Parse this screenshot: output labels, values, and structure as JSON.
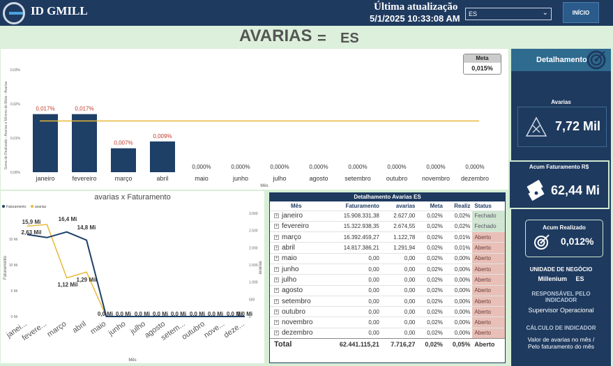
{
  "header": {
    "brand": "ID GMILL",
    "update_label": "Última atualização",
    "update_value": "5/1/2025 10:33:08 AM",
    "filter_value": "ES",
    "home_button": "INÍCIO"
  },
  "title": {
    "main": "AVARIAS",
    "dash": "=",
    "uf": "ES"
  },
  "chart_data": [
    {
      "type": "bar",
      "title": "",
      "ylabel": "Soma de Realizado - Avarias e Mínimo de Meta - Avarias",
      "xlabel": "Mês",
      "categories": [
        "janeiro",
        "fevereiro",
        "março",
        "abril",
        "maio",
        "junho",
        "julho",
        "agosto",
        "setembro",
        "outubro",
        "novembro",
        "dezembro"
      ],
      "values": [
        0.017,
        0.017,
        0.007,
        0.009,
        0,
        0,
        0,
        0,
        0,
        0,
        0,
        0
      ],
      "data_labels": [
        "0,017%",
        "0,017%",
        "0,007%",
        "0,009%",
        "0,000%",
        "0,000%",
        "0,000%",
        "0,000%",
        "0,000%",
        "0,000%",
        "0,000%",
        "0,000%"
      ],
      "meta_line": 0.015,
      "ylim": [
        0,
        0.03
      ],
      "yticks": [
        "0,00%",
        "0,01%",
        "0,02%",
        "0,03%"
      ],
      "colors": {
        "bar": "#1e3f66",
        "meta": "#e8b838",
        "label_pos": "#c0392b",
        "label_zero": "#333333"
      },
      "meta_card": {
        "label": "Meta",
        "value": "0,015%"
      }
    },
    {
      "type": "line",
      "title": "avarias x Faturamento",
      "xlabel": "Mês",
      "ylabel_left": "Faturamento",
      "ylabel_right": "avarias",
      "categories": [
        "janei...",
        "fevere...",
        "março",
        "abril",
        "maio",
        "junho",
        "julho",
        "agosto",
        "setem...",
        "outubro",
        "nove...",
        "deze..."
      ],
      "series": [
        {
          "name": "Faturamento",
          "color": "#1e3f66",
          "values": [
            15.9,
            15.3,
            16.4,
            14.8,
            0,
            0,
            0,
            0,
            0,
            0,
            0,
            0
          ]
        },
        {
          "name": "avarias",
          "color": "#e8b838",
          "values": [
            2627,
            2674.55,
            1122.78,
            1291.94,
            0,
            0,
            0,
            0,
            0,
            0,
            0,
            0
          ]
        }
      ],
      "data_labels": [
        "15,9 Mi",
        "2,63 Mil",
        "16,4 Mi",
        "14,8 Mi",
        "1,12 Mil",
        "1,29 Mil",
        "0,0 Mi",
        "0,0 Mi",
        "0,0 Mi",
        "0,0 Mi",
        "0,0 Mi",
        "0,0 Mi",
        "0,0 Mi",
        "0,0 Mi",
        "0,0 Mi"
      ],
      "ylim_left": [
        0,
        20
      ],
      "ylim_right": [
        0,
        3000
      ],
      "yticks_left": [
        "0 Mi",
        "5 Mi",
        "10 Mi",
        "15 Mi"
      ],
      "yticks_right": [
        "0",
        "500",
        "1.000",
        "1.500",
        "2.000",
        "2.500",
        "3.000"
      ]
    }
  ],
  "table": {
    "title": "Detalhamento Avarias ES",
    "columns": [
      "Mês",
      "Faturamento",
      "avarias",
      "Meta",
      "Realiz",
      "Status"
    ],
    "rows": [
      [
        "janeiro",
        "15.908.331,38",
        "2.627,00",
        "0,02%",
        "0,02%",
        "Fechado"
      ],
      [
        "fevereiro",
        "15.322.938,35",
        "2.674,55",
        "0,02%",
        "0,02%",
        "Fechado"
      ],
      [
        "março",
        "16.392.459,27",
        "1.122,78",
        "0,02%",
        "0,01%",
        "Aberto"
      ],
      [
        "abril",
        "14.817.386,21",
        "1.291,94",
        "0,02%",
        "0,01%",
        "Aberto"
      ],
      [
        "maio",
        "0,00",
        "0,00",
        "0,02%",
        "0,00%",
        "Aberto"
      ],
      [
        "junho",
        "0,00",
        "0,00",
        "0,02%",
        "0,00%",
        "Aberto"
      ],
      [
        "julho",
        "0,00",
        "0,00",
        "0,02%",
        "0,00%",
        "Aberto"
      ],
      [
        "agosto",
        "0,00",
        "0,00",
        "0,02%",
        "0,00%",
        "Aberto"
      ],
      [
        "setembro",
        "0,00",
        "0,00",
        "0,02%",
        "0,00%",
        "Aberto"
      ],
      [
        "outubro",
        "0,00",
        "0,00",
        "0,02%",
        "0,00%",
        "Aberto"
      ],
      [
        "novembro",
        "0,00",
        "0,00",
        "0,02%",
        "0,00%",
        "Aberto"
      ],
      [
        "dezembro",
        "0,00",
        "0,00",
        "0,02%",
        "0,00%",
        "Aberto"
      ]
    ],
    "total": [
      "Total",
      "62.441.115,21",
      "7.716,27",
      "0,02%",
      "0,05%",
      "Aberto"
    ]
  },
  "side": {
    "header": "Detalhamento",
    "avarias_label": "Avarias",
    "avarias_value": "7,72 Mil",
    "fat_label": "Acum Faturamento R$",
    "fat_value": "62,44 Mi",
    "real_label": "Acum Realizado",
    "real_value": "0,012%",
    "un_label": "UNIDADE DE NEGÓCIO",
    "un_value_name": "Millenium",
    "un_value_uf": "ES",
    "resp_label": "RESPONSÁVEL PELO INDICADOR",
    "resp_value": "Supervisor Operacional",
    "calc_label": "CÁLCULO DE INDICADOR",
    "calc_value": "Valor de avarias no mês / Pelo faturamento do mês"
  }
}
